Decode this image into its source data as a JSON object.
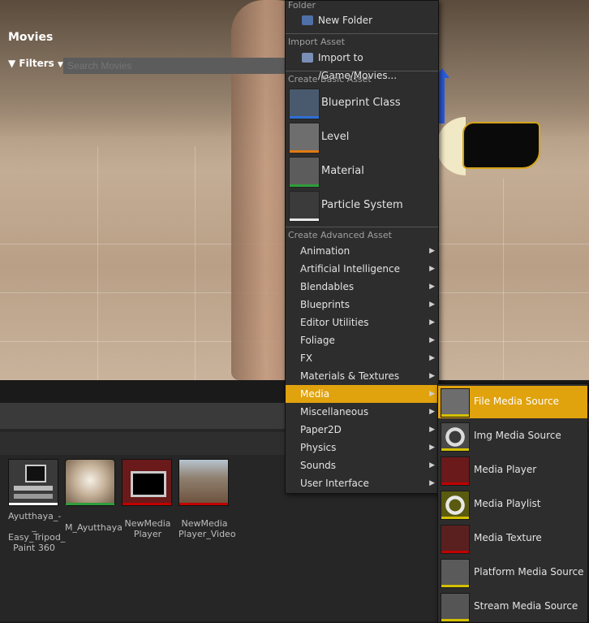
{
  "menu": {
    "folder_header": "Folder",
    "new_folder": "New Folder",
    "import_header": "Import Asset",
    "import_to": "Import to /Game/Movies...",
    "basic_header": "Create Basic Asset",
    "basic_items": [
      {
        "label": "Blueprint Class",
        "icon": "blueprint-icon",
        "color": "#2f6fd6"
      },
      {
        "label": "Level",
        "icon": "level-icon",
        "color": "#e07a13"
      },
      {
        "label": "Material",
        "icon": "material-icon",
        "color": "#2e9e3a"
      },
      {
        "label": "Particle System",
        "icon": "particle-icon",
        "color": "#e8e8e8"
      }
    ],
    "advanced_header": "Create Advanced Asset",
    "advanced_items": [
      "Animation",
      "Artificial Intelligence",
      "Blendables",
      "Blueprints",
      "Editor Utilities",
      "Foliage",
      "FX",
      "Materials & Textures",
      "Media",
      "Miscellaneous",
      "Paper2D",
      "Physics",
      "Sounds",
      "User Interface"
    ],
    "selected": "Media"
  },
  "submenu": {
    "items": [
      {
        "label": "File Media Source",
        "icon": "file-media-source-icon",
        "color": "#d4c000"
      },
      {
        "label": "Img Media Source",
        "icon": "img-media-source-icon",
        "color": "#d4c000"
      },
      {
        "label": "Media Player",
        "icon": "media-player-icon",
        "color": "#c00000"
      },
      {
        "label": "Media Playlist",
        "icon": "media-playlist-icon",
        "color": "#d4c000"
      },
      {
        "label": "Media Texture",
        "icon": "media-texture-icon",
        "color": "#c00000"
      },
      {
        "label": "Platform Media Source",
        "icon": "platform-media-source-icon",
        "color": "#d4c000"
      },
      {
        "label": "Stream Media Source",
        "icon": "stream-media-source-icon",
        "color": "#d4c000"
      }
    ],
    "selected": "File Media Source"
  },
  "content_browser": {
    "title": "Movies",
    "filters_label": "Filters",
    "search_placeholder": "Search Movies",
    "assets": [
      {
        "label": "Ayutthaya_-_Easy_Tripod_Paint 360",
        "line1": "Ayutthaya_-_",
        "line2": "Easy_Tripod_",
        "line3": "Paint      360",
        "color": "#ffffff"
      },
      {
        "label": "M_Ayutthaya",
        "line1": "M_Ayutthaya",
        "line2": "",
        "line3": "",
        "color": "#2e9e3a"
      },
      {
        "label": "NewMedia Player",
        "line1": "NewMedia",
        "line2": "Player",
        "line3": "",
        "color": "#c00000"
      },
      {
        "label": "NewMedia Player_Video",
        "line1": "NewMedia",
        "line2": "Player_Video",
        "line3": "",
        "color": "#c00000"
      }
    ]
  }
}
